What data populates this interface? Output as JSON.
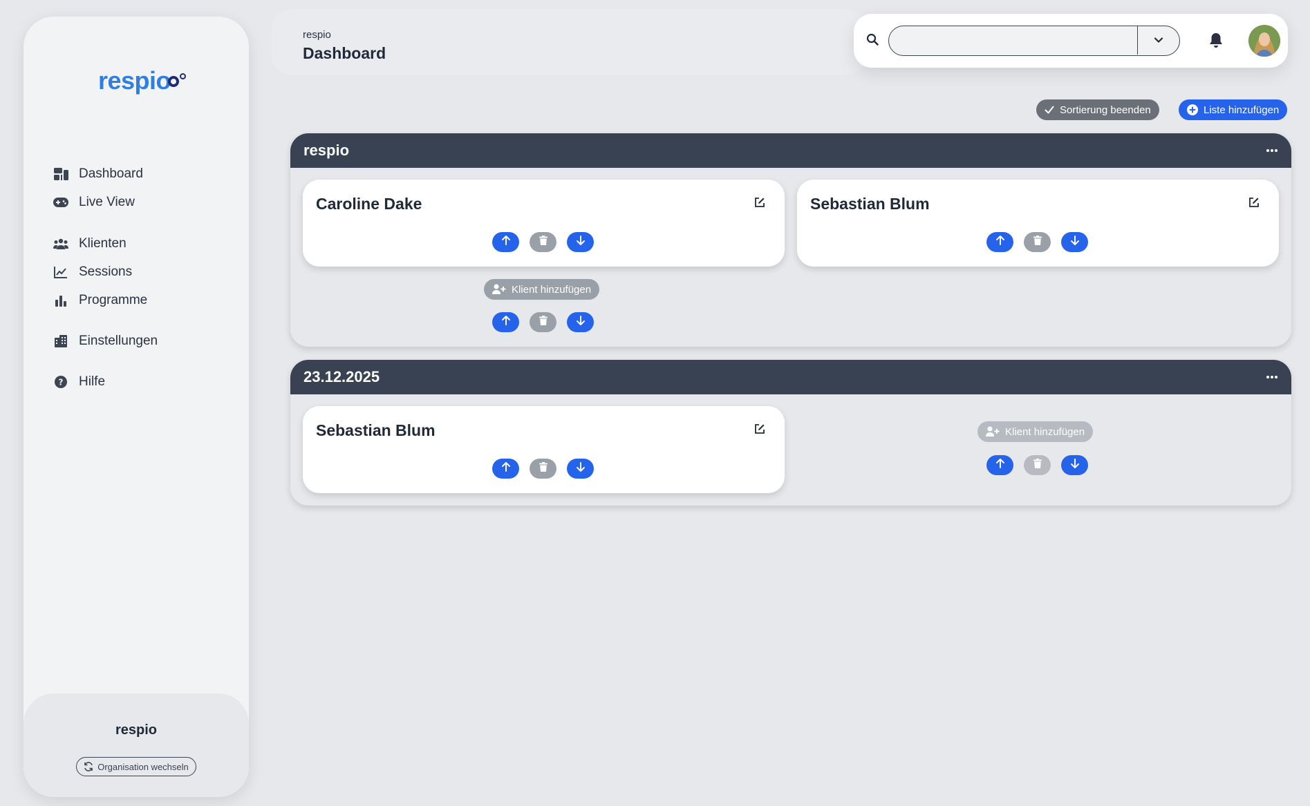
{
  "app": {
    "logo_text": "respio"
  },
  "sidebar": {
    "items": [
      {
        "label": "Dashboard",
        "icon": "dashboard-icon"
      },
      {
        "label": "Live View",
        "icon": "gamepad-icon"
      },
      {
        "label": "Klienten",
        "icon": "users-icon"
      },
      {
        "label": "Sessions",
        "icon": "chart-line-icon"
      },
      {
        "label": "Programme",
        "icon": "bar-chart-icon"
      },
      {
        "label": "Einstellungen",
        "icon": "building-icon"
      },
      {
        "label": "Hilfe",
        "icon": "help-icon"
      }
    ],
    "org_name": "respio",
    "org_switch_label": "Organisation wechseln"
  },
  "header": {
    "breadcrumb": "respio",
    "title": "Dashboard",
    "search": {
      "value": "",
      "placeholder": ""
    }
  },
  "toolbar": {
    "finish_sorting_label": "Sortierung beenden",
    "add_list_label": "Liste hinzufügen"
  },
  "lists": [
    {
      "title": "respio",
      "clients": [
        "Caroline Dake",
        "Sebastian Blum"
      ],
      "add_client_label": "Klient hinzufügen"
    },
    {
      "title": "23.12.2025",
      "clients": [
        "Sebastian Blum"
      ],
      "add_client_label": "Klient hinzufügen"
    }
  ],
  "colors": {
    "accent": "#2563eb",
    "list_header": "#384253",
    "logo": "#2f7fe0",
    "background": "#e6e8ec"
  }
}
